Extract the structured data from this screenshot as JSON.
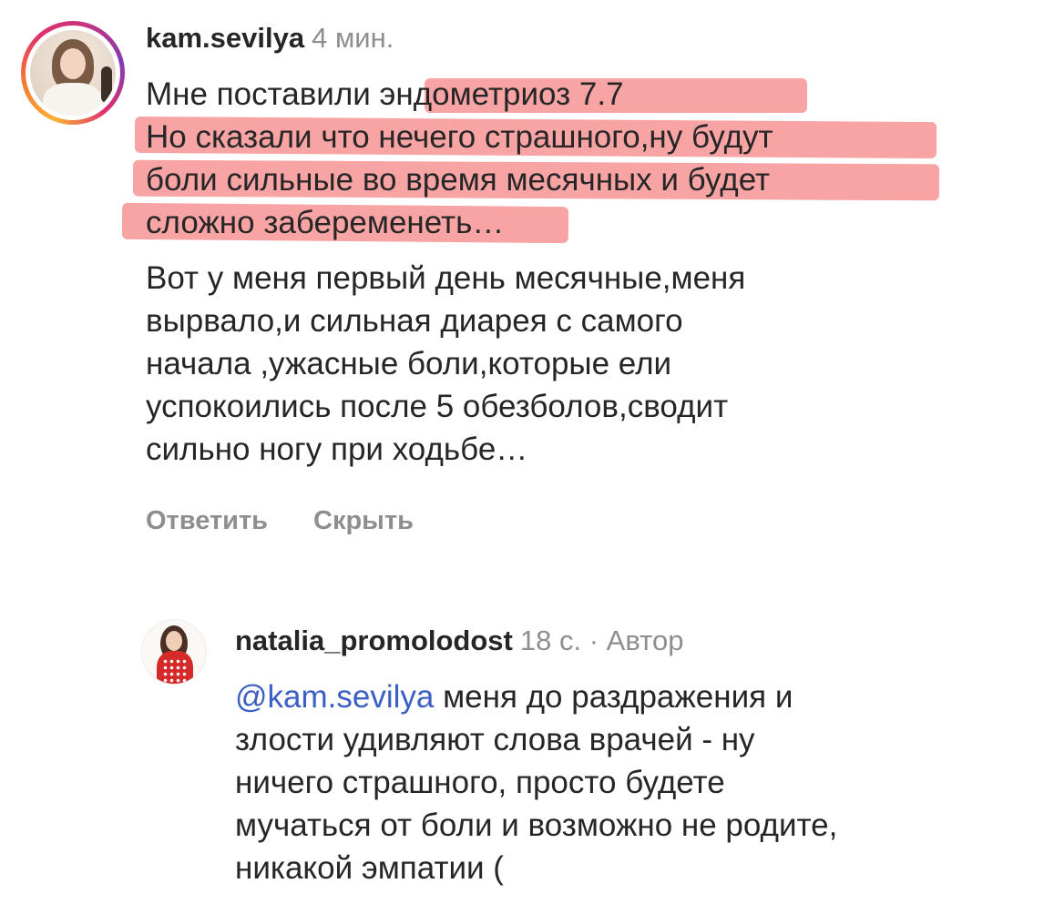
{
  "comment1": {
    "username": "kam.sevilya",
    "time": "4 мин.",
    "lines": [
      {
        "before": "Мне поставили ",
        "highlight": "эндометриоз 7.7",
        "after": ""
      },
      {
        "before": "",
        "highlight": "Но сказали что нечего страшного,ну будут",
        "after": ""
      },
      {
        "before": "",
        "highlight": "боли сильные во время месячных и будет",
        "after": ""
      },
      {
        "before": "",
        "highlight": "сложно забеременеть",
        "after": "…"
      }
    ],
    "paragraph": "Вот у меня первый день месячные,меня вырвало,и сильная диарея с самого начала ,ужасные боли,которые ели успокоились после 5 обезболов,сводит сильно ногу при ходьбе…",
    "paragraph_lines": [
      "Вот у меня первый день месячные,меня",
      "вырвало,и сильная диарея с самого",
      "начала ,ужасные боли,которые ели",
      "успокоились после 5 обезболов,сводит",
      "сильно ногу при ходьбе…"
    ],
    "reply_label": "Ответить",
    "hide_label": "Скрыть"
  },
  "comment2": {
    "username": "natalia_promolodost",
    "time": "18 с.",
    "separator": " · ",
    "author_badge": "Автор",
    "mention": "@kam.sevilya",
    "lines": [
      " меня до раздражения и",
      "злости удивляют слова врачей - ну",
      "ничего страшного, просто будете",
      "мучаться от боли и возможно не родите,",
      "никакой эмпатии ("
    ]
  },
  "colors": {
    "highlight": "#f25a5a",
    "mention": "#3b5fc4",
    "secondary_text": "#8e8e8e",
    "primary_text": "#262626"
  }
}
